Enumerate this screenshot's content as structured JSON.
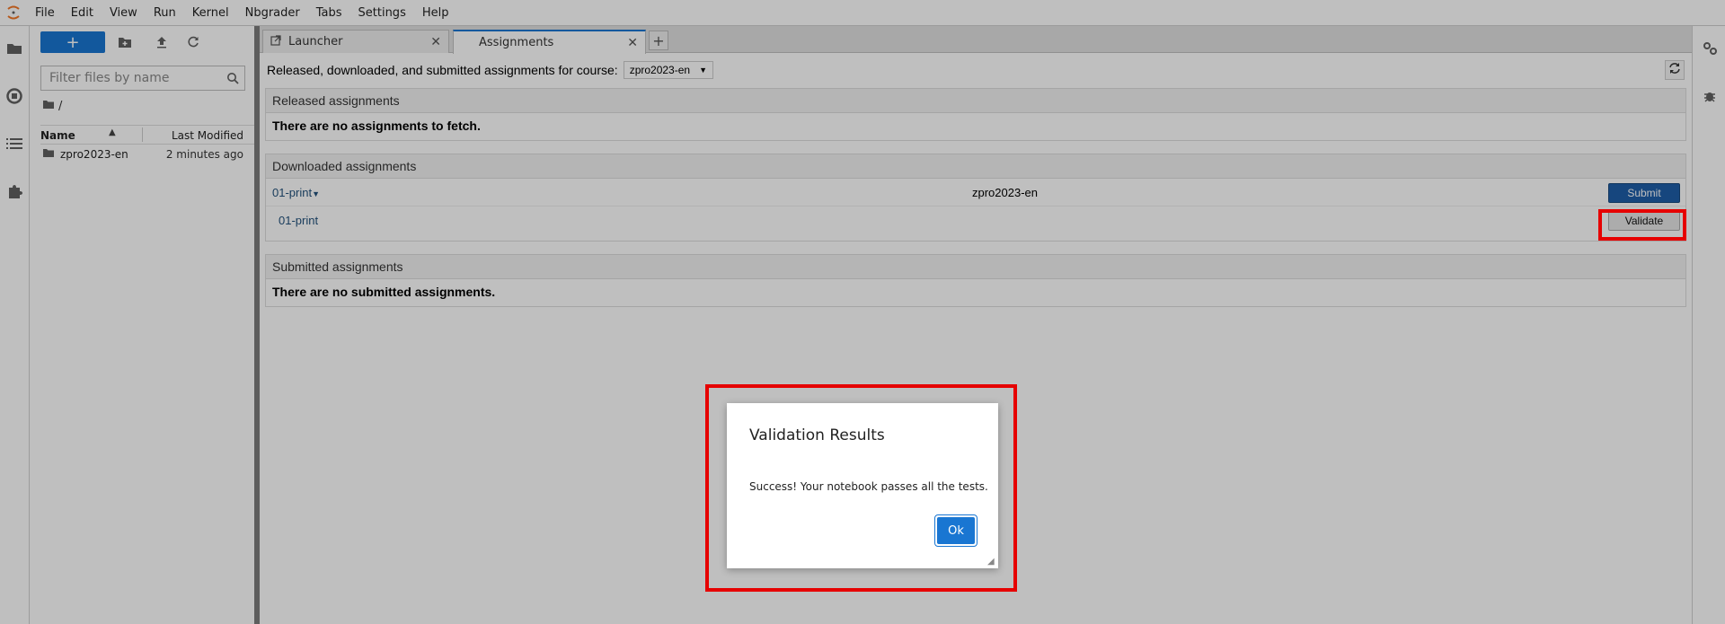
{
  "menubar": {
    "items": [
      "File",
      "Edit",
      "View",
      "Run",
      "Kernel",
      "Nbgrader",
      "Tabs",
      "Settings",
      "Help"
    ]
  },
  "filebrowser": {
    "new_label": "+",
    "search_placeholder": "Filter files by name",
    "breadcrumb": "/",
    "col_name": "Name",
    "col_modified": "Last Modified",
    "rows": [
      {
        "name": "zpro2023-en",
        "modified": "2 minutes ago"
      }
    ]
  },
  "tabs": [
    {
      "label": "Launcher",
      "active": false
    },
    {
      "label": "Assignments",
      "active": true
    }
  ],
  "assignments": {
    "course_prompt": "Released, downloaded, and submitted assignments for course:",
    "course_selected": "zpro2023-en",
    "released": {
      "heading": "Released assignments",
      "empty_text": "There are no assignments to fetch."
    },
    "downloaded": {
      "heading": "Downloaded assignments",
      "assignment_name": "01-print",
      "course": "zpro2023-en",
      "submit_label": "Submit",
      "notebook_name": "01-print",
      "validate_label": "Validate"
    },
    "submitted": {
      "heading": "Submitted assignments",
      "empty_text": "There are no submitted assignments."
    }
  },
  "dialog": {
    "title": "Validation Results",
    "message": "Success! Your notebook passes all the tests.",
    "ok_label": "Ok"
  },
  "colors": {
    "accent": "#1976d2",
    "highlight": "#e60000",
    "submit": "#1e5ea8"
  }
}
